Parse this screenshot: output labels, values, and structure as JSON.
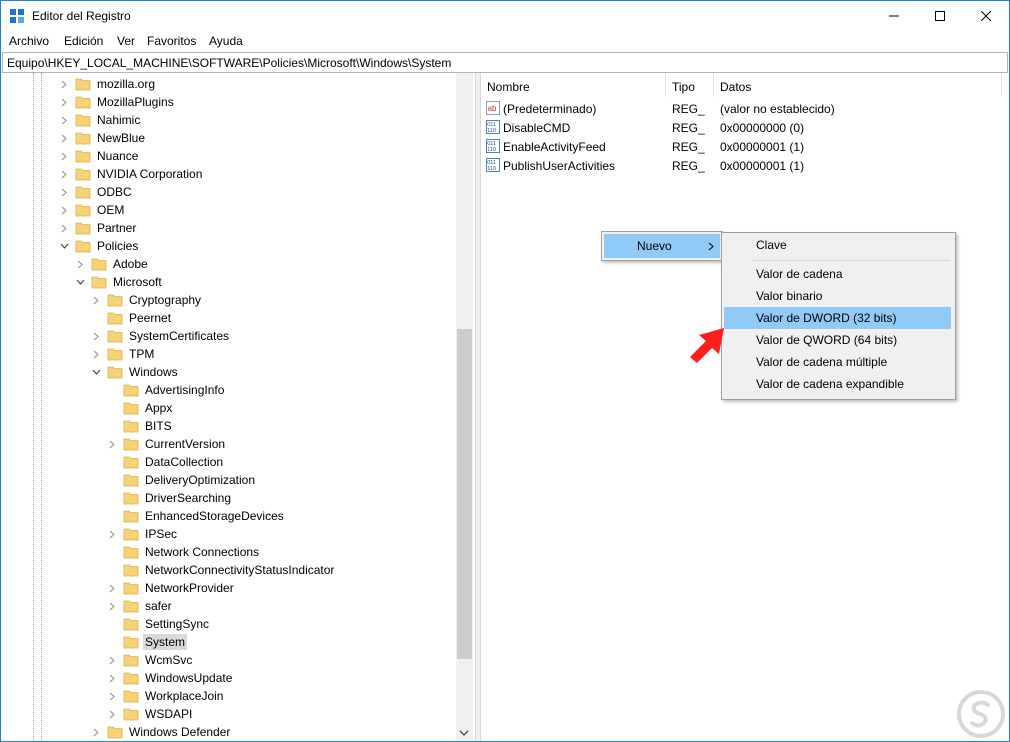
{
  "window": {
    "title": "Editor del Registro"
  },
  "menu": [
    "Archivo",
    "Edición",
    "Ver",
    "Favoritos",
    "Ayuda"
  ],
  "address": "Equipo\\HKEY_LOCAL_MACHINE\\SOFTWARE\\Policies\\Microsoft\\Windows\\System",
  "tree": [
    {
      "label": "mozilla.org",
      "expander": "collapsed"
    },
    {
      "label": "MozillaPlugins",
      "expander": "collapsed"
    },
    {
      "label": "Nahimic",
      "expander": "collapsed"
    },
    {
      "label": "NewBlue",
      "expander": "collapsed"
    },
    {
      "label": "Nuance",
      "expander": "collapsed"
    },
    {
      "label": "NVIDIA Corporation",
      "expander": "collapsed"
    },
    {
      "label": "ODBC",
      "expander": "collapsed"
    },
    {
      "label": "OEM",
      "expander": "collapsed"
    },
    {
      "label": "Partner",
      "expander": "collapsed"
    },
    {
      "label": "Policies",
      "expander": "expanded"
    },
    {
      "label": "Adobe",
      "expander": "collapsed"
    },
    {
      "label": "Microsoft",
      "expander": "expanded"
    },
    {
      "label": "Cryptography",
      "expander": "collapsed"
    },
    {
      "label": "Peernet",
      "expander": "none"
    },
    {
      "label": "SystemCertificates",
      "expander": "collapsed"
    },
    {
      "label": "TPM",
      "expander": "collapsed"
    },
    {
      "label": "Windows",
      "expander": "expanded"
    },
    {
      "label": "AdvertisingInfo",
      "expander": "none"
    },
    {
      "label": "Appx",
      "expander": "none"
    },
    {
      "label": "BITS",
      "expander": "none"
    },
    {
      "label": "CurrentVersion",
      "expander": "collapsed"
    },
    {
      "label": "DataCollection",
      "expander": "none"
    },
    {
      "label": "DeliveryOptimization",
      "expander": "none"
    },
    {
      "label": "DriverSearching",
      "expander": "none"
    },
    {
      "label": "EnhancedStorageDevices",
      "expander": "none"
    },
    {
      "label": "IPSec",
      "expander": "collapsed"
    },
    {
      "label": "Network Connections",
      "expander": "none"
    },
    {
      "label": "NetworkConnectivityStatusIndicator",
      "expander": "none"
    },
    {
      "label": "NetworkProvider",
      "expander": "collapsed"
    },
    {
      "label": "safer",
      "expander": "collapsed"
    },
    {
      "label": "SettingSync",
      "expander": "none"
    },
    {
      "label": "System",
      "expander": "none",
      "selected": true
    },
    {
      "label": "WcmSvc",
      "expander": "collapsed"
    },
    {
      "label": "WindowsUpdate",
      "expander": "collapsed"
    },
    {
      "label": "WorkplaceJoin",
      "expander": "collapsed"
    },
    {
      "label": "WSDAPI",
      "expander": "collapsed"
    },
    {
      "label": "Windows Defender",
      "expander": "collapsed"
    }
  ],
  "list": {
    "columns": {
      "name": "Nombre",
      "type": "Tipo",
      "data": "Datos"
    },
    "rows": [
      {
        "name": "(Predeterminado)",
        "type": "REG_",
        "data": "(valor no establecido)",
        "icon": "string-value-icon"
      },
      {
        "name": "DisableCMD",
        "type": "REG_",
        "data": "0x00000000 (0)",
        "icon": "binary-value-icon"
      },
      {
        "name": "EnableActivityFeed",
        "type": "REG_",
        "data": "0x00000001 (1)",
        "icon": "binary-value-icon"
      },
      {
        "name": "PublishUserActivities",
        "type": "REG_",
        "data": "0x00000001 (1)",
        "icon": "binary-value-icon"
      }
    ]
  },
  "context_menu": {
    "nuevo_label": "Nuevo",
    "submenu": [
      "Clave",
      "Valor de cadena",
      "Valor binario",
      "Valor de DWORD (32 bits)",
      "Valor de QWORD (64 bits)",
      "Valor de cadena múltiple",
      "Valor de cadena expandible"
    ],
    "highlighted": "Valor de DWORD (32 bits)"
  },
  "colors": {
    "highlight": "#91c9f7",
    "folder": "#f5d477",
    "arrow": "#ff1e1e"
  }
}
